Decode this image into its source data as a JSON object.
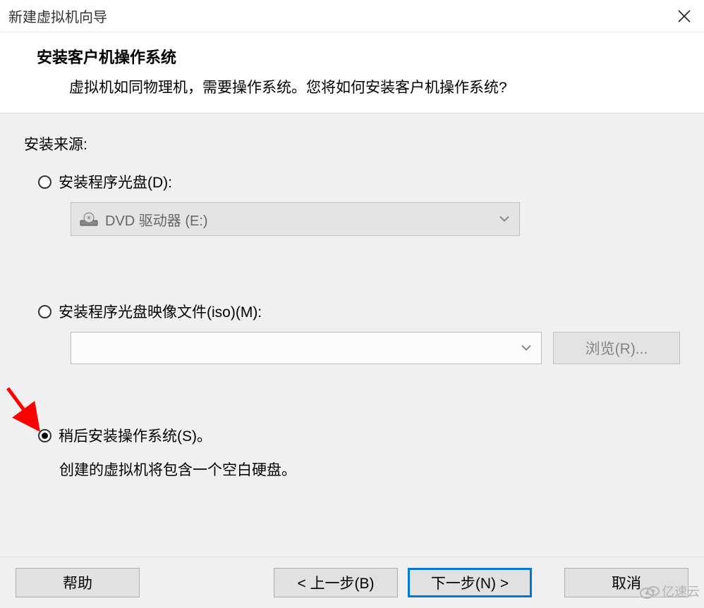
{
  "window": {
    "title": "新建虚拟机向导",
    "close_label": "✕"
  },
  "header": {
    "heading": "安装客户机操作系统",
    "subheading": "虚拟机如同物理机，需要操作系统。您将如何安装客户机操作系统?"
  },
  "body": {
    "source_label": "安装来源:",
    "option_disc": {
      "label": "安装程序光盘(D):",
      "drive_text": "DVD 驱动器 (E:)",
      "selected": false,
      "enabled": false
    },
    "option_iso": {
      "label": "安装程序光盘映像文件(iso)(M):",
      "path_value": "",
      "browse_label": "浏览(R)...",
      "selected": false,
      "enabled": false
    },
    "option_later": {
      "label": "稍后安装操作系统(S)。",
      "note": "创建的虚拟机将包含一个空白硬盘。",
      "selected": true
    }
  },
  "footer": {
    "help": "帮助",
    "back": "< 上一步(B)",
    "next": "下一步(N) >",
    "cancel": "取消"
  },
  "watermark": {
    "text": "亿速云"
  }
}
